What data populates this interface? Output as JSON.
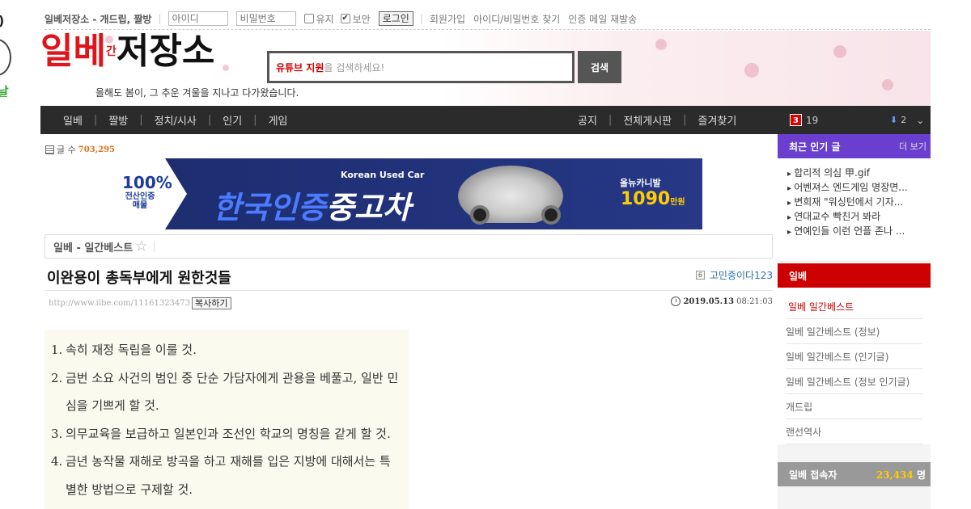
{
  "left_ad": {
    "top_text": ")",
    "bottom_text": "날"
  },
  "topbar": {
    "site_name": "일베저장소 - 개드립, 짤방",
    "id_placeholder": "아이디",
    "pw_placeholder": "비밀번호",
    "keep_label": "유지",
    "secure_label": "보안",
    "login_label": "로그인",
    "signup_label": "회원가입",
    "find_label": "아이디/비밀번호 찾기",
    "resend_label": "인증 메일 재발송"
  },
  "header": {
    "logo_red": "일베",
    "logo_small": "간",
    "logo_black": "저장소",
    "slogan": "올해도 봄이, 그 추운 겨울을 지나고 다가왔습니다.",
    "search_highlight": "유튜브 지원",
    "search_placeholder": "을 검색하세요!",
    "search_button": "검색"
  },
  "nav": {
    "items": [
      "일베",
      "짤방",
      "정치/시사",
      "인기",
      "게임"
    ],
    "right_items": [
      "공지",
      "전체게시판",
      "즐겨찾기"
    ],
    "badge": "3",
    "count": "19",
    "download_count": "2"
  },
  "post_count": {
    "label": "글 수",
    "value": "703,295"
  },
  "ad_banner": {
    "pct": "100%",
    "pct_sub": "전산인증 매물",
    "kuc": "Korean Used Car",
    "main_a": "한국인증",
    "main_b": "중고차",
    "model": "올뉴카니발",
    "price": "1090",
    "price_unit": "만원"
  },
  "board": {
    "name": "일베 - 일간베스트",
    "star": "☆"
  },
  "post": {
    "title": "이완용이 총독부에게 원한것들",
    "level": "6",
    "author": "고민중이다123",
    "url": "http://www.ilbe.com/11161323473",
    "copy_label": "복사하기",
    "date": "2019.05.13",
    "time": "08:21:03",
    "lines": [
      {
        "n": "1.",
        "text": "속히 재정 독립을 이룰 것."
      },
      {
        "n": "2.",
        "text": "금번 소요 사건의 범인 중 단순 가담자에게 관용을 베풀고, 일반 민"
      },
      {
        "n": "",
        "text": "심을 기쁘게 할 것."
      },
      {
        "n": "3.",
        "text": "의무교육을 보급하고 일본인과 조선인 학교의 명칭을 같게 할 것."
      },
      {
        "n": "4.",
        "text": "금년 농작물 재해로 방곡을 하고 재해를 입은 지방에 대해서는 특"
      },
      {
        "n": "",
        "text": "별한 방법으로 구제할 것."
      }
    ]
  },
  "sidebar": {
    "popular_title": "최근 인기 글",
    "more_label": "더 보기",
    "popular": [
      "합리적 의심 甲.gif",
      "어벤져스 엔드게임 명장면...",
      "변희재 \"워싱턴에서 기자...",
      "연대교수 빡친거 봐라",
      "연예인들 이런 언플 존나 ..."
    ],
    "category": "일베",
    "list": [
      "일베 일간베스트",
      "일베 일간베스트 (정보)",
      "일베 일간베스트 (인기글)",
      "일베 일간베스트 (정보 인기글)",
      "개드립",
      "랜선역사"
    ],
    "visitors_label": "일베 접속자",
    "visitors_count": "23,434",
    "visitors_unit": "명"
  },
  "colors": {
    "nav_bg": "#2b2b2b",
    "popular_head": "#6a3fd0",
    "category_red": "#cc0000",
    "accent_orange": "#e0701b"
  }
}
